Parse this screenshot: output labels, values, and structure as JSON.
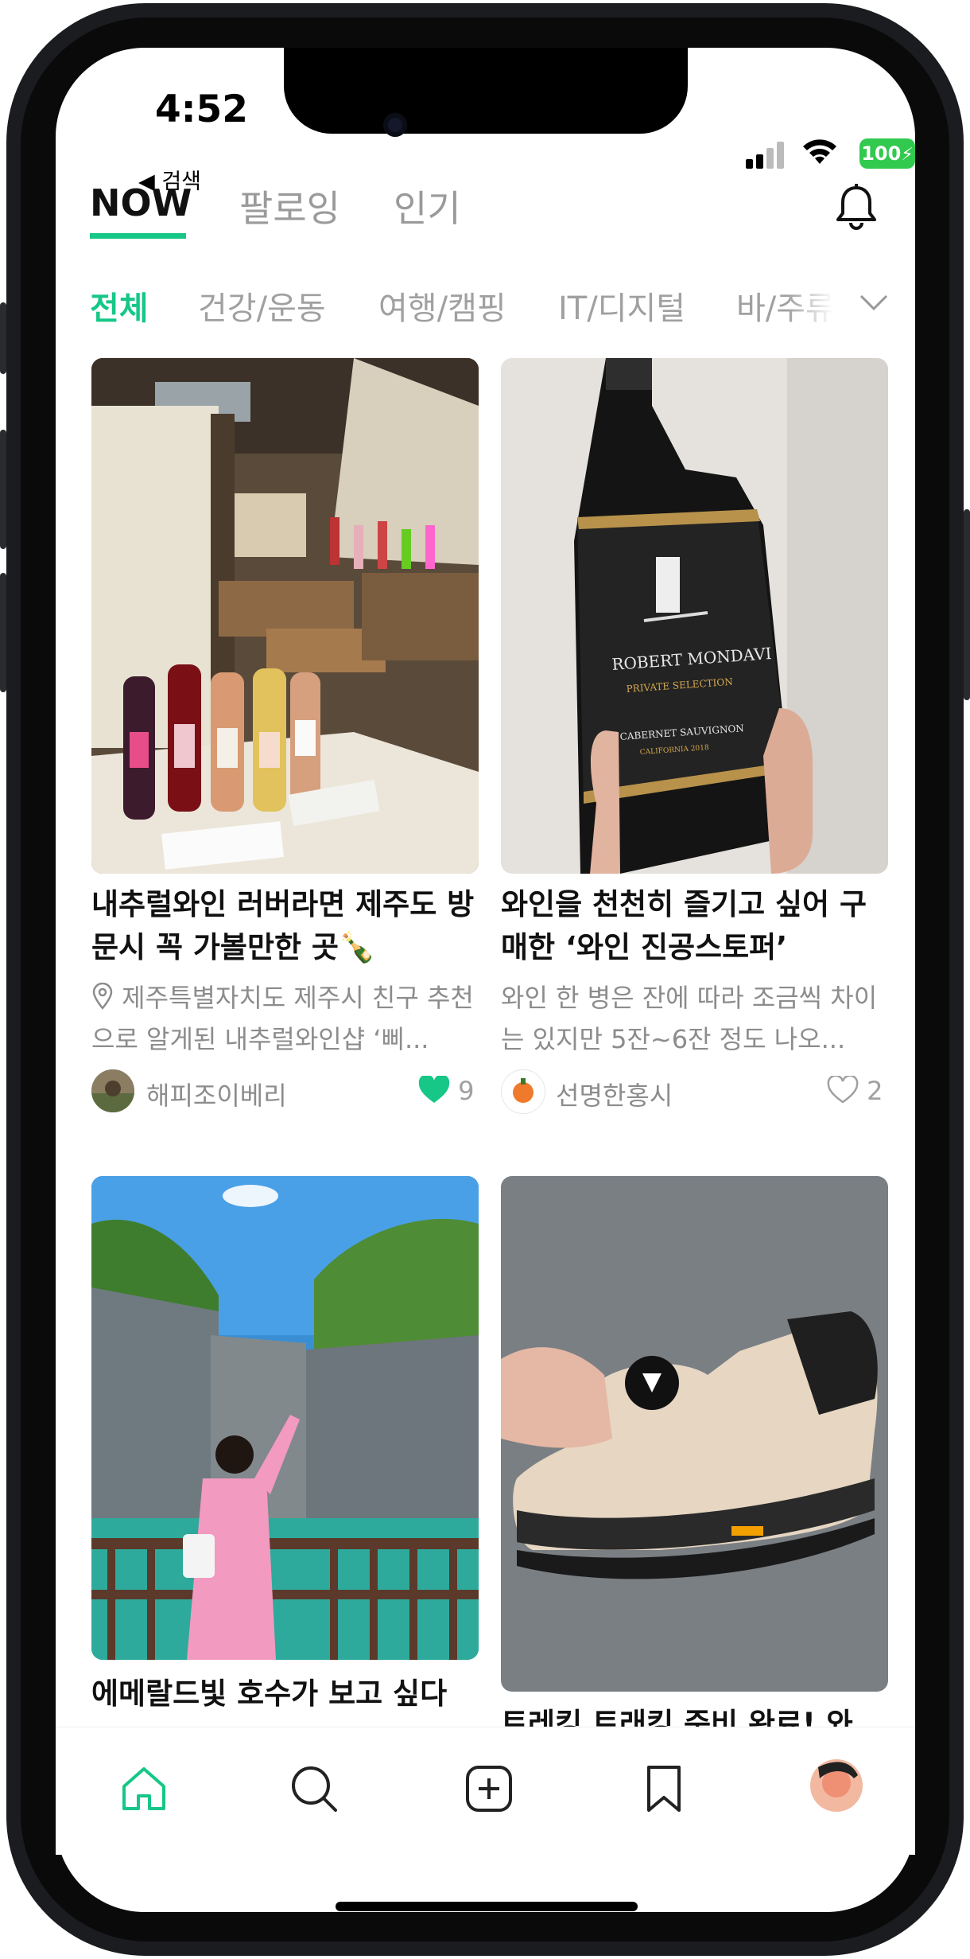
{
  "status": {
    "time": "4:52",
    "back_label": "◀ 검색",
    "battery": "100"
  },
  "tabs": [
    {
      "label": "NOW"
    },
    {
      "label": "팔로잉"
    },
    {
      "label": "인기"
    }
  ],
  "categories": [
    "전체",
    "건강/운동",
    "여행/캠핑",
    "IT/디지털",
    "바/주류"
  ],
  "posts": [
    {
      "title": "내추럴와인 러버라면 제주도 방문시 꼭 가볼만한 곳🍾",
      "desc": "제주특별자치도 제주시 친구 추천으로 알게된 내추럴와인샵 ‘삐...",
      "user": "해피조이베리",
      "likes": "9"
    },
    {
      "title": "와인을 천천히 즐기고 싶어 구매한 ‘와인 진공스토퍼’",
      "desc": "와인 한 병은 잔에 따라 조금씩 차이는 있지만 5잔~6잔 정도 나오...",
      "user": "선명한홍시",
      "likes": "2"
    },
    {
      "title": "에메랄드빛 호수가 보고 싶다"
    },
    {
      "title": "트레킹 트래킹 준비 완료! 와"
    }
  ],
  "bottle": {
    "brand": "ROBERT MONDAVI",
    "line": "PRIVATE SELECTION",
    "variety": "CABERNET SAUVIGNON",
    "region": "CALIFORNIA 2018"
  },
  "nav": [
    "home-icon",
    "search-icon",
    "add-icon",
    "bookmark-icon",
    "profile-avatar"
  ],
  "colors": {
    "accent": "#16c787",
    "heart": "#16c787"
  }
}
